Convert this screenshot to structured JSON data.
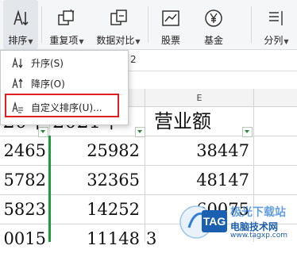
{
  "ribbon": {
    "sort": {
      "label": "排序",
      "icon": "sort-icon"
    },
    "duplicates": {
      "label": "重复项",
      "icon": "duplicates-icon"
    },
    "compare": {
      "label": "数据对比",
      "icon": "compare-icon"
    },
    "stocks": {
      "label": "股票",
      "icon": "stock-chart-icon"
    },
    "funds": {
      "label": "基金",
      "icon": "yen-icon"
    },
    "split": {
      "label": "分列",
      "icon": "split-columns-icon"
    }
  },
  "dropdown_menu": {
    "items": [
      {
        "label": "升序(S)",
        "icon": "sort-ascending-icon"
      },
      {
        "label": "降序(O)",
        "icon": "sort-descending-icon"
      },
      {
        "label": "自定义排序(U)...",
        "icon": "custom-sort-icon"
      }
    ]
  },
  "formula_bar": {
    "cell_ref_fragment": "2"
  },
  "columns": {
    "e": "E"
  },
  "table": {
    "header": [
      "20年",
      "2021年",
      "营业额"
    ],
    "rows": [
      [
        "2465",
        "25982",
        "38447"
      ],
      [
        "5782",
        "32365",
        "48147"
      ],
      [
        "5823",
        "14252",
        "60075"
      ],
      [
        "0015",
        "11148",
        "3"
      ]
    ]
  },
  "watermark": {
    "brand": "TAG",
    "line1": "极光下载站",
    "line2": "电脑技术网",
    "url": "www.tagxp.com"
  },
  "colors": {
    "highlight": "#e02020",
    "filter_arrow": "#2a8a3a",
    "brand_blue": "#1b5fb0"
  }
}
